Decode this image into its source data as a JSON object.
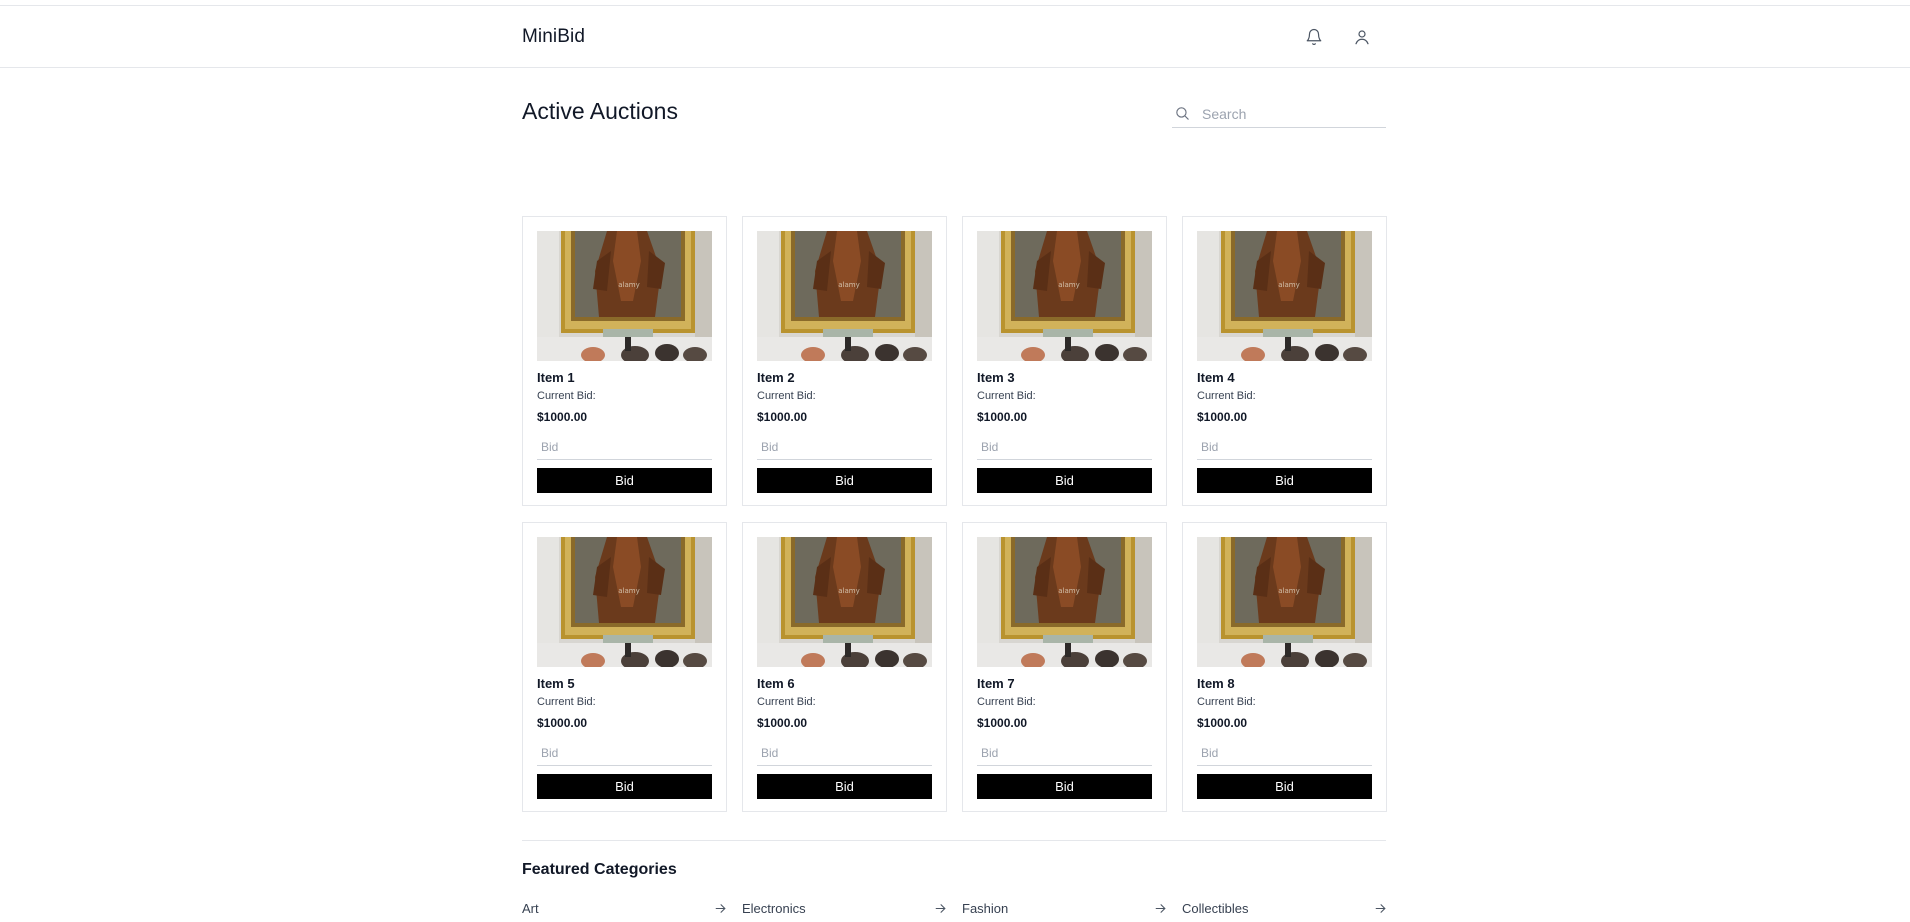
{
  "header": {
    "brand": "MiniBid",
    "icons": [
      "bell-icon",
      "user-icon"
    ]
  },
  "main": {
    "title": "Active Auctions",
    "search": {
      "placeholder": "Search",
      "value": ""
    }
  },
  "items": [
    {
      "name": "Item 1",
      "bid_label": "Current Bid:",
      "bid_value": "$1000.00",
      "input_placeholder": "Bid",
      "button_label": "Bid"
    },
    {
      "name": "Item 2",
      "bid_label": "Current Bid:",
      "bid_value": "$1000.00",
      "input_placeholder": "Bid",
      "button_label": "Bid"
    },
    {
      "name": "Item 3",
      "bid_label": "Current Bid:",
      "bid_value": "$1000.00",
      "input_placeholder": "Bid",
      "button_label": "Bid"
    },
    {
      "name": "Item 4",
      "bid_label": "Current Bid:",
      "bid_value": "$1000.00",
      "input_placeholder": "Bid",
      "button_label": "Bid"
    },
    {
      "name": "Item 5",
      "bid_label": "Current Bid:",
      "bid_value": "$1000.00",
      "input_placeholder": "Bid",
      "button_label": "Bid"
    },
    {
      "name": "Item 6",
      "bid_label": "Current Bid:",
      "bid_value": "$1000.00",
      "input_placeholder": "Bid",
      "button_label": "Bid"
    },
    {
      "name": "Item 7",
      "bid_label": "Current Bid:",
      "bid_value": "$1000.00",
      "input_placeholder": "Bid",
      "button_label": "Bid"
    },
    {
      "name": "Item 8",
      "bid_label": "Current Bid:",
      "bid_value": "$1000.00",
      "input_placeholder": "Bid",
      "button_label": "Bid"
    }
  ],
  "featured": {
    "title": "Featured Categories",
    "categories": [
      "Art",
      "Electronics",
      "Fashion",
      "Collectibles"
    ]
  },
  "colors": {
    "accent_button": "#000000",
    "border": "#e5e7eb",
    "text": "#111827",
    "muted_text": "#9ca3af"
  }
}
